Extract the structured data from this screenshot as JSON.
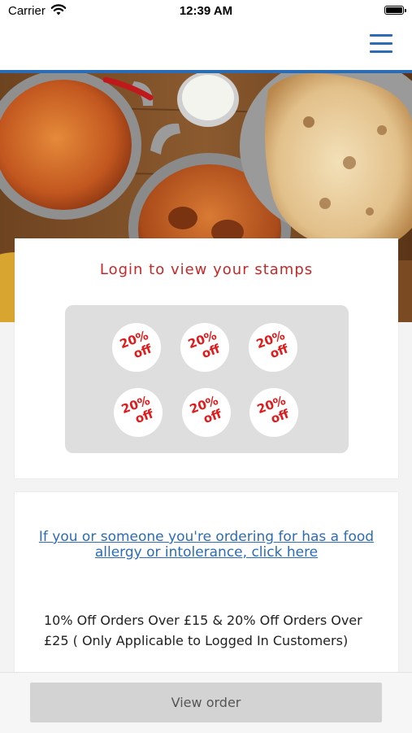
{
  "status_bar": {
    "carrier": "Carrier",
    "time": "12:39 AM",
    "wifi_icon": "wifi-icon",
    "battery_icon": "battery-icon"
  },
  "header": {
    "menu_icon": "hamburger-menu-icon",
    "accent_color": "#2b6cb5"
  },
  "hero": {
    "image": "indian-food-curry-naan-photo"
  },
  "stamps": {
    "title": "Login to view your stamps",
    "title_color": "#c62828",
    "items": [
      {
        "line1": "20%",
        "line2": "off"
      },
      {
        "line1": "20%",
        "line2": "off"
      },
      {
        "line1": "20%",
        "line2": "off"
      },
      {
        "line1": "20%",
        "line2": "off"
      },
      {
        "line1": "20%",
        "line2": "off"
      },
      {
        "line1": "20%",
        "line2": "off"
      }
    ]
  },
  "info": {
    "allergy_link": "If you or someone you're ordering for has a food allergy or intolerance, click here",
    "offer_text": "10% Off Orders Over £15 & 20% Off Orders Over £25 ( Only Applicable to Logged In Customers)"
  },
  "footer": {
    "view_order_label": "View order"
  }
}
